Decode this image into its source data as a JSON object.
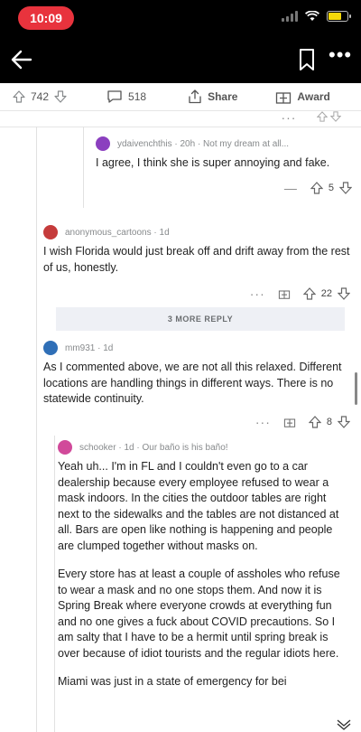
{
  "status": {
    "time": "10:09"
  },
  "post_actions": {
    "votes": "742",
    "comments": "518",
    "share": "Share",
    "award": "Award"
  },
  "comments": [
    {
      "author": "ydaivenchthis",
      "meta_extra": "· 20h · Not my dream at all...",
      "body": "I agree, I think she is super annoying and fake.",
      "score": "5",
      "avatar_color": "#8b3fbf"
    },
    {
      "author": "anonymous_cartoons",
      "meta_extra": "· 1d",
      "body": "I wish Florida would just break off and drift away from the rest of us, honestly.",
      "score": "22",
      "avatar_color": "#c53b3b"
    },
    {
      "author": "mm931",
      "meta_extra": "· 1d",
      "body": "As I commented above, we are not all this relaxed. Different locations are handling things in different ways.  There is no statewide continuity.",
      "score": "8",
      "avatar_color": "#2f6fb7"
    },
    {
      "author": "schooker",
      "meta_extra": "· 1d · Our baño is his baño!",
      "body_paragraphs": [
        "Yeah uh... I'm in FL and I couldn't even go to a car dealership because every employee refused to wear a mask indoors. In the cities the outdoor tables are right next to the sidewalks and the tables are not distanced at all. Bars are open like nothing is happening and people are clumped together without masks on.",
        "Every store has at least a couple of assholes who refuse to wear a mask and no one stops them. And now it is Spring Break where everyone crowds at everything fun and no one gives a fuck about COVID precautions. So I am salty that I have to be a hermit until spring break is over because of idiot tourists and the regular idiots here.",
        "Miami was just in a state of emergency for bei"
      ],
      "avatar_color": "#d14a9a"
    }
  ],
  "more_replies": "3 MORE REPLY"
}
